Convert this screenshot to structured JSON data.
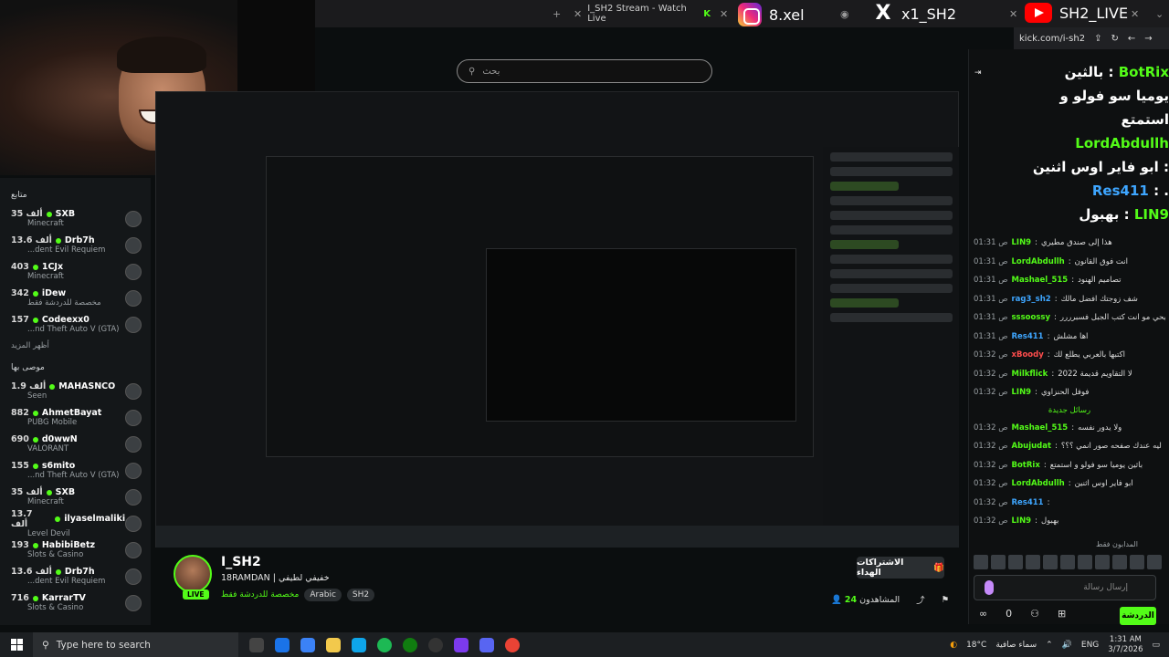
{
  "browser": {
    "tabs": [
      {
        "label": "I_SH2 Stream - Watch Live"
      },
      {
        "label": "8.xel"
      },
      {
        "label": "x1_SH2"
      },
      {
        "label": "SH2_LIVE"
      }
    ],
    "url": "kick.com/i-sh2"
  },
  "socials": {
    "instagram": "8.xel",
    "x": "x1_SH2",
    "youtube": "SH2_LIVE"
  },
  "search": {
    "placeholder": "بحث"
  },
  "sidebar": {
    "title": "متابع",
    "following": [
      {
        "name": "SXB",
        "viewers": "35 ألف",
        "game": "Minecraft"
      },
      {
        "name": "Drb7h",
        "viewers": "13.6 ألف",
        "game": "...dent Evil Requiem"
      },
      {
        "name": "1CJx",
        "viewers": "403",
        "game": "Minecraft"
      },
      {
        "name": "iDew",
        "viewers": "342",
        "game": "مخصصة للدردشة فقط"
      },
      {
        "name": "Codeexx0",
        "viewers": "157",
        "game": "...nd Theft Auto V (GTA)"
      }
    ],
    "show_more": "أظهر المزيد",
    "recommended_title": "موصى بها",
    "recommended": [
      {
        "name": "MAHASNCO",
        "viewers": "1.9 ألف",
        "game": "Seen"
      },
      {
        "name": "AhmetBayat",
        "viewers": "882",
        "game": "PUBG Mobile"
      },
      {
        "name": "d0wwN",
        "viewers": "690",
        "game": "VALORANT"
      },
      {
        "name": "s6mito",
        "viewers": "155",
        "game": "...nd Theft Auto V (GTA)"
      },
      {
        "name": "SXB",
        "viewers": "35 ألف",
        "game": "Minecraft"
      },
      {
        "name": "ilyaselmaliki",
        "viewers": "13.7 ألف",
        "game": "Level Devil"
      },
      {
        "name": "HabibiBetz",
        "viewers": "193",
        "game": "Slots & Casino"
      },
      {
        "name": "Drb7h",
        "viewers": "13.6 ألف",
        "game": "...dent Evil Requiem"
      },
      {
        "name": "KarrarTV",
        "viewers": "716",
        "game": "Slots & Casino"
      }
    ]
  },
  "streamer": {
    "name": "I_SH2",
    "title": "18RAMDAN | خفيفي لطيفي",
    "category": "مخصصة للدردشة فقط",
    "tags": [
      "Arabic",
      "SH2"
    ],
    "live": "LIVE",
    "subscribe": "الاشتراكات الهداء",
    "viewers_label": "المشاهدون",
    "viewers": "24"
  },
  "overlay_chat": [
    {
      "user": "BotRix",
      "prefix": "بالثين :",
      "text": "يوميا سو فولو و استمتع"
    },
    {
      "user": "LordAbdullh",
      "text": "ابو فاير اوس اثنين :"
    },
    {
      "user": "Res411",
      "text": ":  ."
    },
    {
      "user": "LIN9",
      "text": "بهبول :"
    }
  ],
  "chat": {
    "messages": [
      {
        "time": "01:31 ص",
        "user": "LIN9",
        "text": "هذا إلى صندق مطيري",
        "color": "green"
      },
      {
        "time": "01:31 ص",
        "user": "LordAbdullh",
        "text": "انت فوق القانون",
        "color": "green"
      },
      {
        "time": "01:31 ص",
        "user": "Mashael_515",
        "text": "تصاميم الهنود",
        "color": "green"
      },
      {
        "time": "01:31 ص",
        "user": "rag3_sh2",
        "text": "شف زوجتك افضل مالك",
        "color": "blue"
      },
      {
        "time": "01:31 ص",
        "user": "sssoossy",
        "text": "يحي مو انت كتب الجبل فسبرررر",
        "color": "green"
      },
      {
        "time": "01:31 ص",
        "user": "Res411",
        "text": "اها مشلش",
        "color": "blue"
      },
      {
        "time": "01:32 ص",
        "user": "xBoody",
        "text": "اكتبها بالعربي يطلع لك",
        "color": "red"
      },
      {
        "time": "01:32 ص",
        "user": "Milkflick",
        "text": "لا التقاويم قديمة 2022",
        "color": "green"
      },
      {
        "time": "01:32 ص",
        "user": "LIN9",
        "text": "فوفل الحنزاوي",
        "color": "green"
      }
    ],
    "divider": "رسائل جديدة",
    "messages_new": [
      {
        "time": "01:32 ص",
        "user": "Mashael_515",
        "text": "ولا يدور نفسه",
        "color": "green"
      },
      {
        "time": "01:32 ص",
        "user": "Abujudat",
        "text": "ليه عندك صفحه صور انمي ؟؟؟",
        "color": "green"
      },
      {
        "time": "01:32 ص",
        "user": "BotRix",
        "text": "باثين يوميا سو فولو و استمتع",
        "color": "green"
      },
      {
        "time": "01:32 ص",
        "user": "LordAbdullh",
        "text": "ابو فاير اوس اثنين",
        "color": "green"
      },
      {
        "time": "01:32 ص",
        "user": "Res411",
        "text": "",
        "color": "blue"
      },
      {
        "time": "01:32 ص",
        "user": "LIN9",
        "text": "بهبول",
        "color": "green"
      }
    ],
    "input_placeholder": "إرسال رسالة",
    "points": "0",
    "send_label": "الدردشة",
    "followers_only": "المدابون فقط"
  },
  "taskbar": {
    "search_placeholder": "Type here to search",
    "weather": "18°C",
    "weather_desc": "سماء صافية",
    "lang": "ENG",
    "time": "1:31 AM",
    "date": "3/7/2026"
  }
}
